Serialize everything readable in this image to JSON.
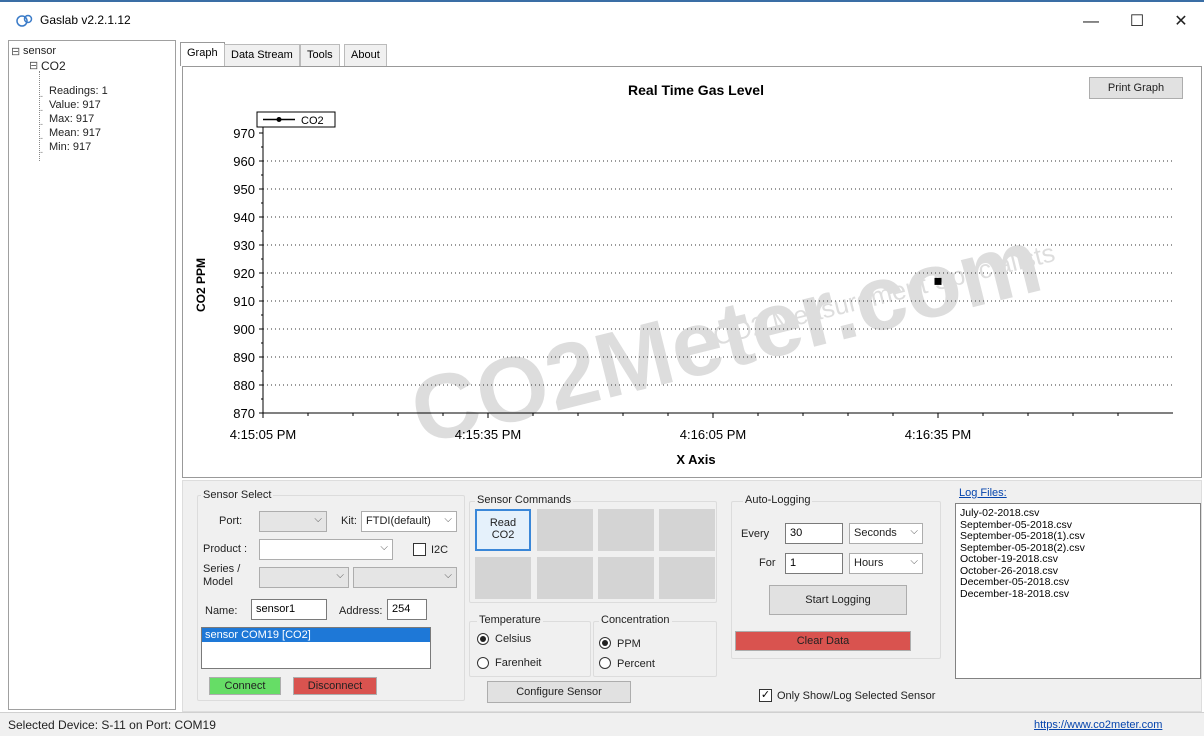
{
  "app": {
    "title": "Gaslab v2.2.1.12"
  },
  "window_controls": {
    "minimize": "—",
    "maximize": "☐",
    "close": "✕"
  },
  "tree": {
    "root": "sensor",
    "child": "CO2",
    "items": [
      "Readings: 1",
      "Value: 917",
      "Max: 917",
      "Mean: 917",
      "Min: 917"
    ],
    "root_toggle": "⊟",
    "child_toggle": "⊟"
  },
  "tabs": [
    {
      "label": "Graph",
      "active": true
    },
    {
      "label": "Data Stream"
    },
    {
      "label": "Tools"
    },
    {
      "label": "About"
    }
  ],
  "graph": {
    "print_button": "Print Graph",
    "watermark_main": "CO2Meter.com",
    "watermark_sub": "CO2 Measurement Specialists"
  },
  "chart_data": {
    "type": "scatter",
    "title": "Real Time Gas Level",
    "xlabel": "X Axis",
    "ylabel": "CO2 PPM",
    "ylim": [
      870,
      970
    ],
    "yticks": [
      970,
      960,
      950,
      940,
      930,
      920,
      910,
      900,
      890,
      880,
      870
    ],
    "xticks": [
      "4:15:05 PM",
      "4:15:35 PM",
      "4:16:05 PM",
      "4:16:35 PM"
    ],
    "grid": "horizontal dotted",
    "legend": "top-left",
    "series": [
      {
        "name": "CO2",
        "color": "#000000",
        "points": [
          {
            "x": "4:16:35 PM",
            "y": 917
          }
        ]
      }
    ]
  },
  "sensor_select": {
    "title": "Sensor Select",
    "port_label": "Port:",
    "port_value": "",
    "kit_label": "Kit:",
    "kit_value": "FTDI(default)",
    "product_label": "Product :",
    "product_value": "",
    "i2c_label": "I2C",
    "series_label": "Series /",
    "model_label": "Model",
    "name_label": "Name:",
    "name_value": "sensor1",
    "address_label": "Address:",
    "address_value": "254",
    "list_selected": "sensor COM19 [CO2]",
    "connect": "Connect",
    "disconnect": "Disconnect"
  },
  "sensor_commands": {
    "title": "Sensor Commands",
    "read_co2": "Read\nCO2"
  },
  "temperature": {
    "title": "Temperature",
    "celsius": "Celsius",
    "farenheit": "Farenheit",
    "selected": "Celsius"
  },
  "concentration": {
    "title": "Concentration",
    "ppm": "PPM",
    "percent": "Percent",
    "selected": "PPM"
  },
  "configure": "Configure Sensor",
  "auto_logging": {
    "title": "Auto-Logging",
    "every_label": "Every",
    "every_value": "30",
    "every_unit": "Seconds",
    "for_label": "For",
    "for_value": "1",
    "for_unit": "Hours",
    "start": "Start Logging",
    "clear": "Clear Data",
    "only_show": "Only Show/Log Selected Sensor"
  },
  "log_files": {
    "title": "Log Files:",
    "files": [
      "July-02-2018.csv",
      "September-05-2018.csv",
      "September-05-2018(1).csv",
      "September-05-2018(2).csv",
      "October-19-2018.csv",
      "October-26-2018.csv",
      "December-05-2018.csv",
      "December-18-2018.csv"
    ]
  },
  "status": {
    "text": "Selected Device: S-11 on Port: COM19",
    "link": "https://www.co2meter.com"
  },
  "colors": {
    "connect": "#66dd66",
    "disconnect": "#d9534f",
    "clear": "#d9534f",
    "link": "#0645ad",
    "selection": "#1e78d7"
  }
}
